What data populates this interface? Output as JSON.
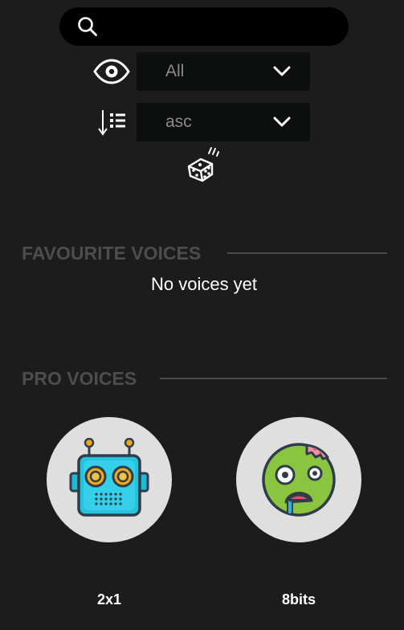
{
  "search": {
    "placeholder": "",
    "value": "",
    "icon": "search-icon"
  },
  "filters": {
    "visibility": {
      "icon": "eye-icon",
      "selected": "All"
    },
    "sort": {
      "icon": "sort-descending-list-icon",
      "selected": "asc"
    },
    "random_icon": "dice-icon"
  },
  "sections": {
    "favourites": {
      "title": "FAVOURITE VOICES",
      "empty_message": "No voices yet"
    },
    "pro": {
      "title": "PRO VOICES",
      "voices": [
        {
          "name": "2x1",
          "icon": "robot-icon"
        },
        {
          "name": "8bits",
          "icon": "zombie-face-icon"
        }
      ]
    }
  },
  "colors": {
    "background": "#1c1c1c",
    "search_bar": "#000000",
    "select_bg": "#0d0f0f",
    "section_title": "#4d4d4d",
    "avatar_bg": "#e0dfe0",
    "text": "#ffffff"
  }
}
